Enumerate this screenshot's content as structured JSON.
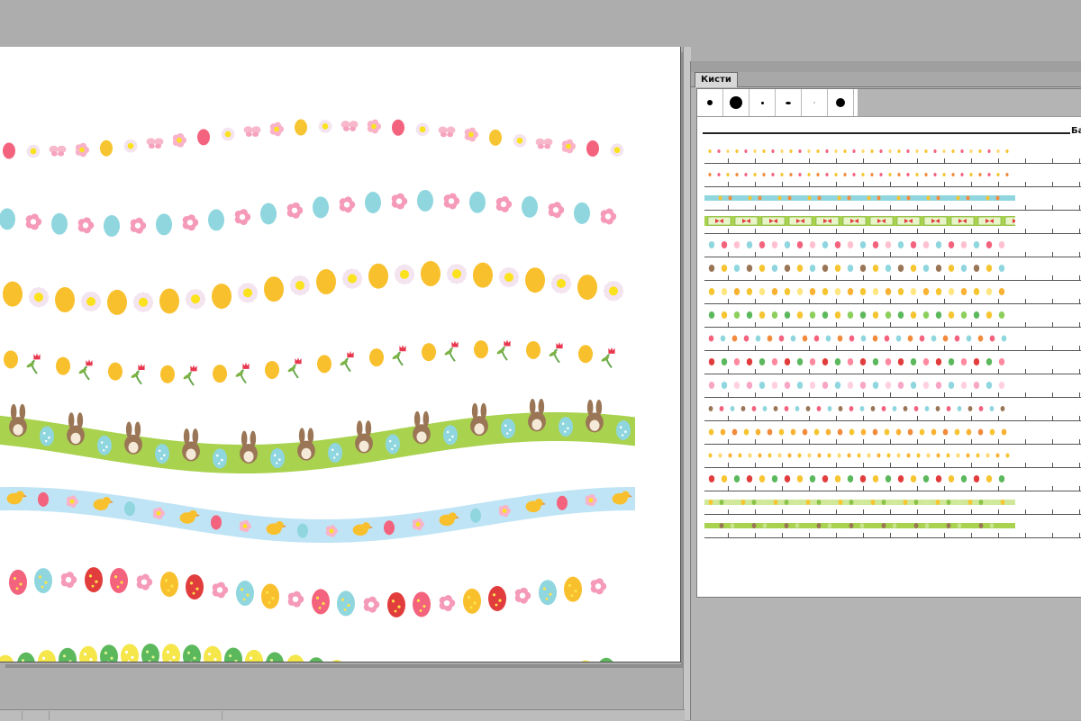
{
  "panel": {
    "tab_label": "Кисти",
    "section_label": "Ба"
  },
  "brush_tips": [
    {
      "name": "tip-small-round"
    },
    {
      "name": "tip-large-round"
    },
    {
      "name": "tip-tiny-dot"
    },
    {
      "name": "tip-tapered"
    },
    {
      "name": "tip-faint"
    },
    {
      "name": "tip-medium-round"
    }
  ],
  "colors": {
    "pink": "#f4637e",
    "yellow": "#f7c531",
    "light_blue": "#8fd6df",
    "green_band": "#a9d24e",
    "blue_band": "#bfe4f5",
    "green_egg": "#5cb85c",
    "orange": "#f28b3c",
    "red": "#e23d3d"
  },
  "brushes": [
    {
      "name": "pink-yellow-dots"
    },
    {
      "name": "orange-pink-dots"
    },
    {
      "name": "blue-chick-ribbon"
    },
    {
      "name": "green-bow-ribbon"
    },
    {
      "name": "blue-egg-flowers"
    },
    {
      "name": "bunny-band"
    },
    {
      "name": "yellow-eggs-daisies"
    },
    {
      "name": "green-eggs"
    },
    {
      "name": "mixed-small-eggs"
    },
    {
      "name": "tulips"
    },
    {
      "name": "butterflies"
    },
    {
      "name": "dotted-bunnies"
    },
    {
      "name": "chicks"
    },
    {
      "name": "small-chicks"
    },
    {
      "name": "tulip-eggs"
    },
    {
      "name": "bee-ribbon"
    },
    {
      "name": "green-bunny-ribbon"
    }
  ]
}
